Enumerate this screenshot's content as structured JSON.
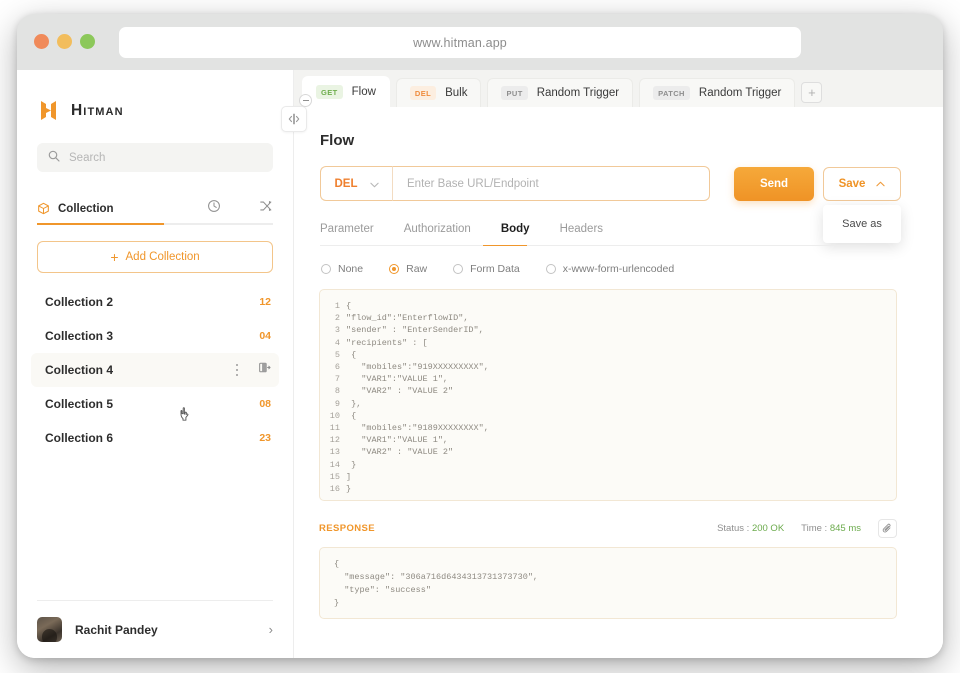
{
  "browser": {
    "url": "www.hitman.app",
    "lights": [
      "close",
      "minimize",
      "maximize"
    ]
  },
  "sidebar": {
    "brand": "Hitman",
    "search": {
      "placeholder": "Search"
    },
    "tabs": [
      {
        "label": "Collection",
        "icon": "cube-icon",
        "active": true
      },
      {
        "label": "",
        "icon": "clock-icon",
        "active": false
      },
      {
        "label": "",
        "icon": "shuffle-icon",
        "active": false
      }
    ],
    "add_collection": "Add Collection",
    "add_plus": "+",
    "collections": [
      {
        "name": "Collection 2",
        "count": "12",
        "hovered": false
      },
      {
        "name": "Collection 3",
        "count": "04",
        "hovered": false
      },
      {
        "name": "Collection 4",
        "count": "",
        "hovered": true
      },
      {
        "name": "Collection 5",
        "count": "08",
        "hovered": false
      },
      {
        "name": "Collection 6",
        "count": "23",
        "hovered": false
      }
    ],
    "user": {
      "name": "Rachit Pandey",
      "chevron": "›"
    }
  },
  "tabbar": {
    "tabs": [
      {
        "method": "GET",
        "method_class": "get",
        "label": "Flow",
        "active": true
      },
      {
        "method": "DEL",
        "method_class": "del",
        "label": "Bulk",
        "active": false
      },
      {
        "method": "PUT",
        "method_class": "put",
        "label": "Random Trigger",
        "active": false
      },
      {
        "method": "PATCH",
        "method_class": "patch",
        "label": "Random Trigger",
        "active": false
      }
    ],
    "add_tab": "+"
  },
  "request": {
    "title": "Flow",
    "method": "DEL",
    "endpoint_placeholder": "Enter Base URL/Endpoint",
    "endpoint_value": "",
    "send_label": "Send",
    "save_label": "Save",
    "save_menu": [
      "Save as"
    ],
    "subtabs": [
      {
        "label": "Parameter",
        "active": false
      },
      {
        "label": "Authorization",
        "active": false
      },
      {
        "label": "Body",
        "active": true
      },
      {
        "label": "Headers",
        "active": false
      }
    ],
    "body_types": [
      {
        "label": "None",
        "checked": false
      },
      {
        "label": "Raw",
        "checked": true
      },
      {
        "label": "Form Data",
        "checked": false
      },
      {
        "label": "x-www-form-urlencoded",
        "checked": false
      }
    ],
    "code_lines": [
      {
        "n": "1",
        "text": "{"
      },
      {
        "n": "2",
        "text": "\"flow_id\":\"EnterflowID\","
      },
      {
        "n": "3",
        "text": "\"sender\" : \"EnterSenderID\","
      },
      {
        "n": "4",
        "text": "\"recipients\" : ["
      },
      {
        "n": "5",
        "text": " {"
      },
      {
        "n": "6",
        "text": "   \"mobiles\":\"919XXXXXXXXX\","
      },
      {
        "n": "7",
        "text": "   \"VAR1\":\"VALUE 1\","
      },
      {
        "n": "8",
        "text": "   \"VAR2\" : \"VALUE 2\""
      },
      {
        "n": "9",
        "text": " },"
      },
      {
        "n": "10",
        "text": " {"
      },
      {
        "n": "11",
        "text": "   \"mobiles\":\"9189XXXXXXXX\","
      },
      {
        "n": "12",
        "text": "   \"VAR1\":\"VALUE 1\","
      },
      {
        "n": "13",
        "text": "   \"VAR2\" : \"VALUE 2\""
      },
      {
        "n": "14",
        "text": " }"
      },
      {
        "n": "15",
        "text": "]"
      },
      {
        "n": "16",
        "text": "}"
      }
    ]
  },
  "response": {
    "title": "RESPONSE",
    "status_label": "Status : ",
    "status_value": "200 OK",
    "time_label": "Time : ",
    "time_value": "845 ms",
    "body_lines": [
      "{",
      "  \"message\": \"306a716d6434313731373730\",",
      "  \"type\": \"success\"",
      "}"
    ]
  },
  "colors": {
    "accent": "#f0962b",
    "send": "#ef9326",
    "success": "#6cab4d",
    "panel_bg": "#fcfbf7"
  }
}
